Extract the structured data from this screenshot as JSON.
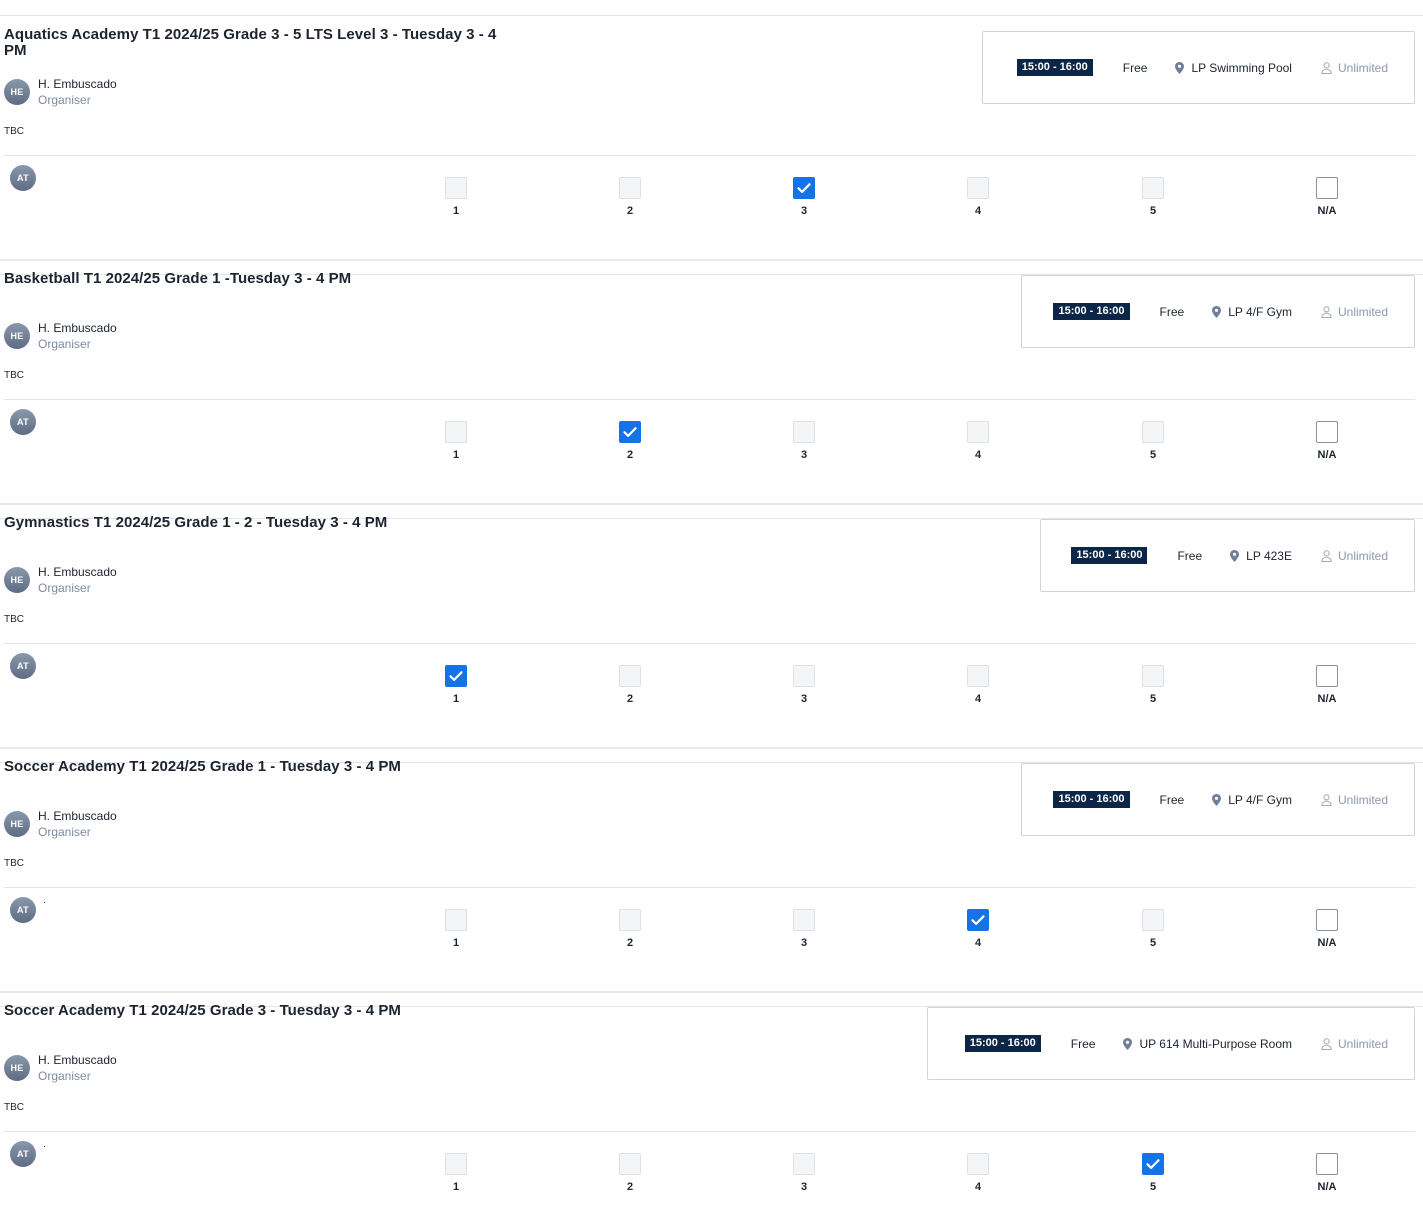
{
  "rating_options": [
    "1",
    "2",
    "3",
    "4",
    "5",
    "N/A"
  ],
  "accent_color": "#1473e6",
  "time_badge_color": "#0c2648",
  "icons": {
    "location": "map-pin-icon",
    "capacity": "person-icon",
    "check": "checkmark-icon"
  },
  "activities": [
    {
      "title": "Aquatics Academy T1 2024/25 Grade 3 - 5 LTS Level 3 - Tuesday 3 - 4 PM",
      "organiser": {
        "initials": "HE",
        "name": "H. Embuscado",
        "role": "Organiser"
      },
      "description": "TBC",
      "time": "15:00 - 16:00",
      "price": "Free",
      "location": "LP Swimming Pool",
      "capacity": "Unlimited",
      "attendee": {
        "initials": "AT",
        "name": ""
      },
      "selected_rating": "3"
    },
    {
      "title": "Basketball T1 2024/25 Grade 1 -Tuesday 3 - 4 PM",
      "organiser": {
        "initials": "HE",
        "name": "H. Embuscado",
        "role": "Organiser"
      },
      "description": "TBC",
      "time": "15:00 - 16:00",
      "price": "Free",
      "location": "LP 4/F Gym",
      "capacity": "Unlimited",
      "attendee": {
        "initials": "AT",
        "name": ""
      },
      "selected_rating": "2"
    },
    {
      "title": "Gymnastics T1 2024/25 Grade 1 - 2 - Tuesday 3 - 4 PM",
      "organiser": {
        "initials": "HE",
        "name": "H. Embuscado",
        "role": "Organiser"
      },
      "description": "TBC",
      "time": "15:00 - 16:00",
      "price": "Free",
      "location": "LP 423E",
      "capacity": "Unlimited",
      "attendee": {
        "initials": "AT",
        "name": ""
      },
      "selected_rating": "1"
    },
    {
      "title": "Soccer Academy T1 2024/25 Grade 1 - Tuesday 3 - 4 PM",
      "organiser": {
        "initials": "HE",
        "name": "H. Embuscado",
        "role": "Organiser"
      },
      "description": "TBC",
      "time": "15:00 - 16:00",
      "price": "Free",
      "location": "LP 4/F Gym",
      "capacity": "Unlimited",
      "attendee": {
        "initials": "AT",
        "name": "."
      },
      "selected_rating": "4"
    },
    {
      "title": "Soccer Academy T1 2024/25 Grade 3 - Tuesday 3 - 4 PM",
      "organiser": {
        "initials": "HE",
        "name": "H. Embuscado",
        "role": "Organiser"
      },
      "description": "TBC",
      "time": "15:00 - 16:00",
      "price": "Free",
      "location": "UP 614 Multi-Purpose Room",
      "capacity": "Unlimited",
      "attendee": {
        "initials": "AT",
        "name": "."
      },
      "selected_rating": "5"
    }
  ]
}
